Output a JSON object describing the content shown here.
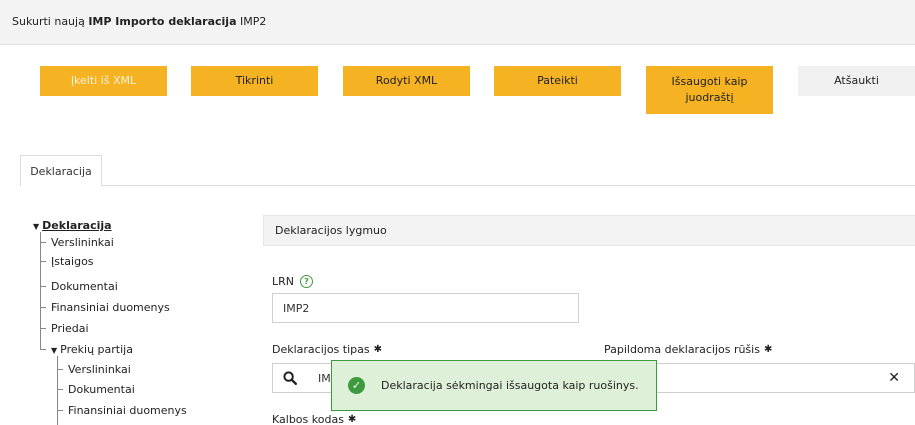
{
  "header": {
    "title_prefix": "Sukurti naują",
    "title_bold": "IMP Importo deklaracija",
    "title_suffix": "IMP2"
  },
  "toolbar": {
    "upload_xml": "Įkelti iš XML",
    "check": "Tikrinti",
    "show_xml": "Rodyti XML",
    "submit": "Pateikti",
    "save_draft": "Išsaugoti kaip juodraštį",
    "cancel": "Atšaukti"
  },
  "tabs": [
    {
      "label": "Deklaracija"
    }
  ],
  "tree": {
    "root": "Deklaracija",
    "items": [
      "Verslininkai",
      "Įstaigos",
      "Dokumentai",
      "Finansiniai duomenys",
      "Priedai"
    ],
    "sub": {
      "label": "Prekių partija",
      "items": [
        "Verslininkai",
        "Dokumentai",
        "Finansiniai duomenys"
      ]
    }
  },
  "section": {
    "title": "Deklaracijos lygmuo"
  },
  "form": {
    "lrn_label": "LRN",
    "lrn_value": "IMP2",
    "decl_type_label": "Deklaracijos tipas",
    "decl_type_value": "IM",
    "extra_type_label": "Papildoma deklaracijos rūšis",
    "lang_label": "Kalbos kodas",
    "required_mark": "✱"
  },
  "toast": {
    "message": "Deklaracija sėkmingai išsaugota kaip ruošinys."
  },
  "colors": {
    "accent": "#f5b223",
    "success": "#3e9a3e",
    "success_bg": "#dff0d8"
  }
}
